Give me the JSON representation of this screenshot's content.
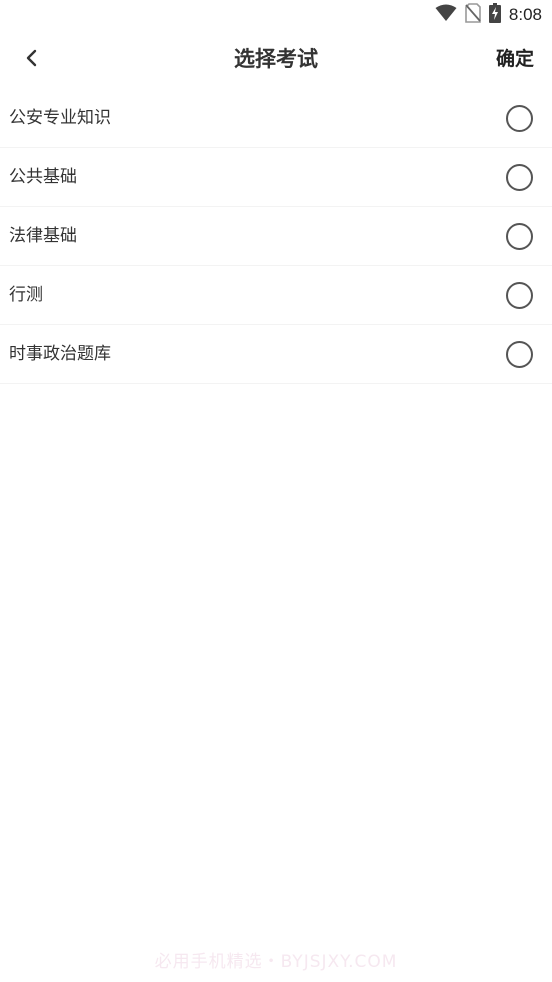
{
  "status_bar": {
    "time": "8:08",
    "icons": [
      "wifi-icon",
      "no-sim-icon",
      "battery-charging-icon"
    ]
  },
  "header": {
    "back_icon": "chevron-left-icon",
    "title": "选择考试",
    "confirm_label": "确定"
  },
  "exams": [
    {
      "label": "公安专业知识",
      "selected": false
    },
    {
      "label": "公共基础",
      "selected": false
    },
    {
      "label": "法律基础",
      "selected": false
    },
    {
      "label": "行测",
      "selected": false
    },
    {
      "label": "时事政治题库",
      "selected": false
    }
  ],
  "watermark": "必用手机精选・BYJSJXY.COM",
  "colors": {
    "text": "#333333",
    "radio_border": "#555555",
    "divider": "#f3f3f3",
    "watermark": "#f6e8f0"
  }
}
